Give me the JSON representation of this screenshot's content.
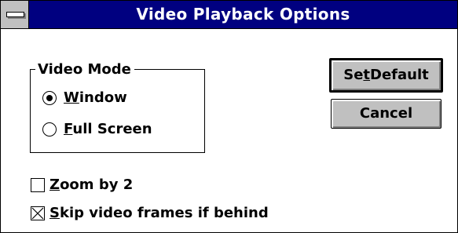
{
  "window": {
    "title": "Video Playback Options"
  },
  "video_mode": {
    "group_label": "Video Mode",
    "options": [
      {
        "prefix": "",
        "mnemonic": "W",
        "rest": "indow",
        "selected": true
      },
      {
        "prefix": "",
        "mnemonic": "F",
        "rest": "ull Screen",
        "selected": false
      }
    ]
  },
  "checkboxes": [
    {
      "prefix": "",
      "mnemonic": "Z",
      "rest": "oom by 2",
      "checked": false
    },
    {
      "prefix": "",
      "mnemonic": "S",
      "rest": "kip video frames if behind",
      "checked": true
    }
  ],
  "buttons": {
    "set_default": {
      "prefix": "Se",
      "mnemonic": "t",
      "rest": " Default"
    },
    "cancel": {
      "label": "Cancel"
    }
  },
  "colors": {
    "title_bar": "#000080",
    "button_face": "#c0c0c0",
    "window_bg": "#ffffff"
  },
  "icons": {
    "system_menu": "system-menu-icon"
  }
}
